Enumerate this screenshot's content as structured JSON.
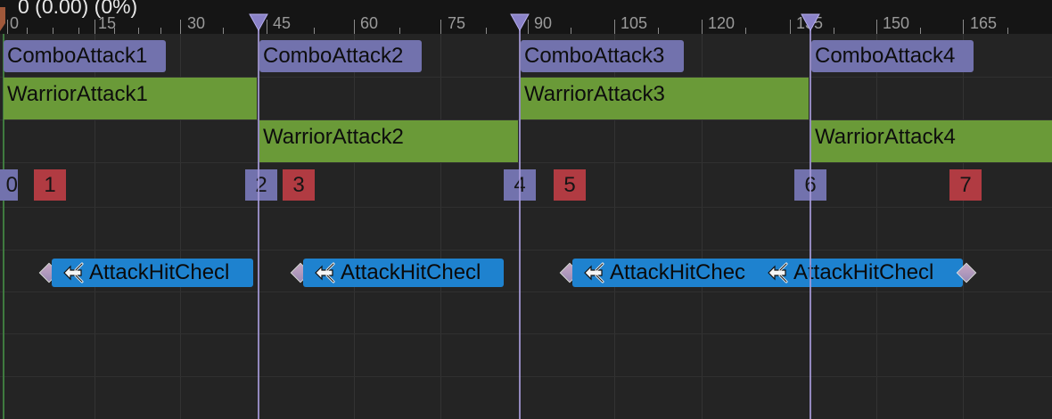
{
  "ruler": {
    "title": "0 (0.00) (0%)",
    "labels": [
      "0",
      "15",
      "30",
      "45",
      "60",
      "75",
      "90",
      "105",
      "120",
      "135",
      "150",
      "165"
    ]
  },
  "tracks": {
    "combo": [
      "ComboAttack1",
      "ComboAttack2",
      "ComboAttack3",
      "ComboAttack4"
    ],
    "warrior": [
      "WarriorAttack1",
      "WarriorAttack2",
      "WarriorAttack3",
      "WarriorAttack4"
    ]
  },
  "branch_points": [
    "0",
    "1",
    "2",
    "3",
    "4",
    "5",
    "6",
    "7"
  ],
  "notifies": [
    "AttackHitChecl",
    "AttackHitChecl",
    "AttackHitChec",
    "AttackHitChecl"
  ],
  "colors": {
    "background": "#242424",
    "ruler": "#151515",
    "section": "#7272ad",
    "montage_segment": "#6a9a38",
    "branch_red": "#b13b42",
    "notify": "#1e82cf",
    "section_line": "#a79bd9"
  },
  "icons": {
    "notify": "branch-arrow-icon",
    "section_marker": "triangle-marker-icon",
    "playhead": "playhead-marker-icon",
    "notify_end": "diamond-handle-icon"
  }
}
